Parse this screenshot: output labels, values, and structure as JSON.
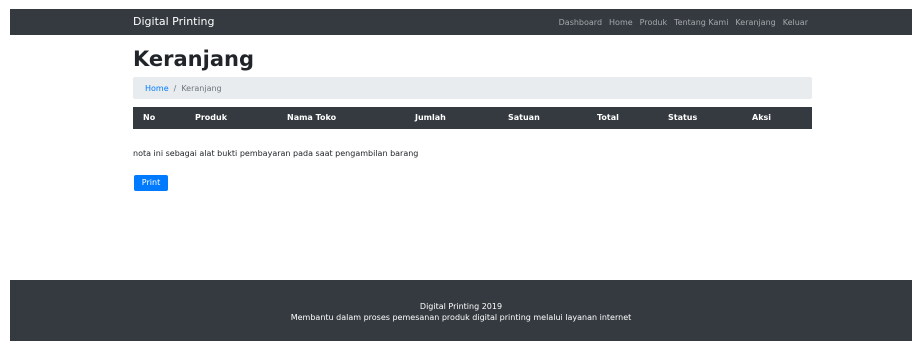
{
  "navbar": {
    "brand": "Digital Printing",
    "links": [
      "Dashboard",
      "Home",
      "Produk",
      "Tentang Kami",
      "Keranjang",
      "Keluar"
    ]
  },
  "page": {
    "title": "Keranjang"
  },
  "breadcrumb": {
    "home": "Home",
    "separator": "/",
    "current": "Keranjang"
  },
  "table": {
    "columns": [
      "No",
      "Produk",
      "Nama Toko",
      "Jumlah",
      "Satuan",
      "Total",
      "Status",
      "Aksi"
    ],
    "rows": []
  },
  "note": "nota ini sebagai alat bukti pembayaran pada saat pengambilan barang",
  "print_label": "Print",
  "footer": {
    "line1": "Digital Printing 2019",
    "line2": "Membantu dalam proses pemesanan produk digital printing melalui layanan internet"
  },
  "colors": {
    "navbar_bg": "#343a40",
    "primary": "#007bff",
    "breadcrumb_bg": "#e9ecef"
  }
}
